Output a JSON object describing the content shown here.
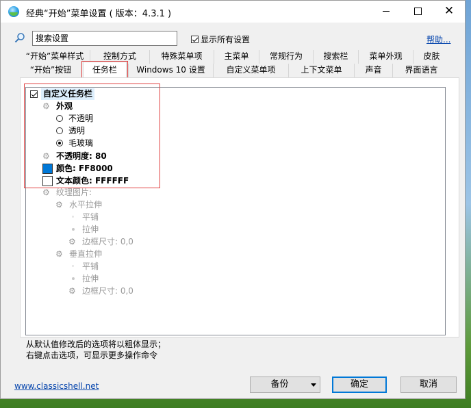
{
  "window": {
    "title": "经典“开始”菜单设置 ( 版本：4.3.1 )"
  },
  "search": {
    "placeholder": "搜索设置",
    "show_all_label": "显示所有设置",
    "show_all_checked": true,
    "help_label": "帮助..."
  },
  "tabs": {
    "row1": [
      "“开始”菜单样式",
      "控制方式",
      "特殊菜单项",
      "主菜单",
      "常规行为",
      "搜索栏",
      "菜单外观",
      "皮肤"
    ],
    "row2": [
      "“开始”按钮",
      "任务栏",
      "Windows 10 设置",
      "自定义菜单项",
      "上下文菜单",
      "声音",
      "界面语言"
    ],
    "active": "任务栏"
  },
  "tree": {
    "root_label": "自定义任务栏",
    "appearance_label": "外观",
    "opt_opaque": "不透明",
    "opt_transparent": "透明",
    "opt_glass": "毛玻璃",
    "opacity_label": "不透明度: 80",
    "color_label": "颜色: FF8000",
    "text_color_label": "文本颜色: FFFFFF",
    "color_swatch": "#0078d7",
    "text_color_swatch": "#ffffff",
    "texture_label": "纹理图片:",
    "h_stretch_label": "水平拉伸",
    "h_tile": "平铺",
    "h_stretch": "拉伸",
    "h_border": "边框尺寸: 0,0",
    "v_stretch_label": "垂直拉伸",
    "v_tile": "平铺",
    "v_stretch": "拉伸",
    "v_border": "边框尺寸: 0,0"
  },
  "hints": {
    "line1": "从默认值修改后的选项将以粗体显示；",
    "line2": "右键点击选项，可显示更多操作命令"
  },
  "footer": {
    "site_link": "www.classicshell.net",
    "backup_label": "备份",
    "ok_label": "确定",
    "cancel_label": "取消"
  }
}
